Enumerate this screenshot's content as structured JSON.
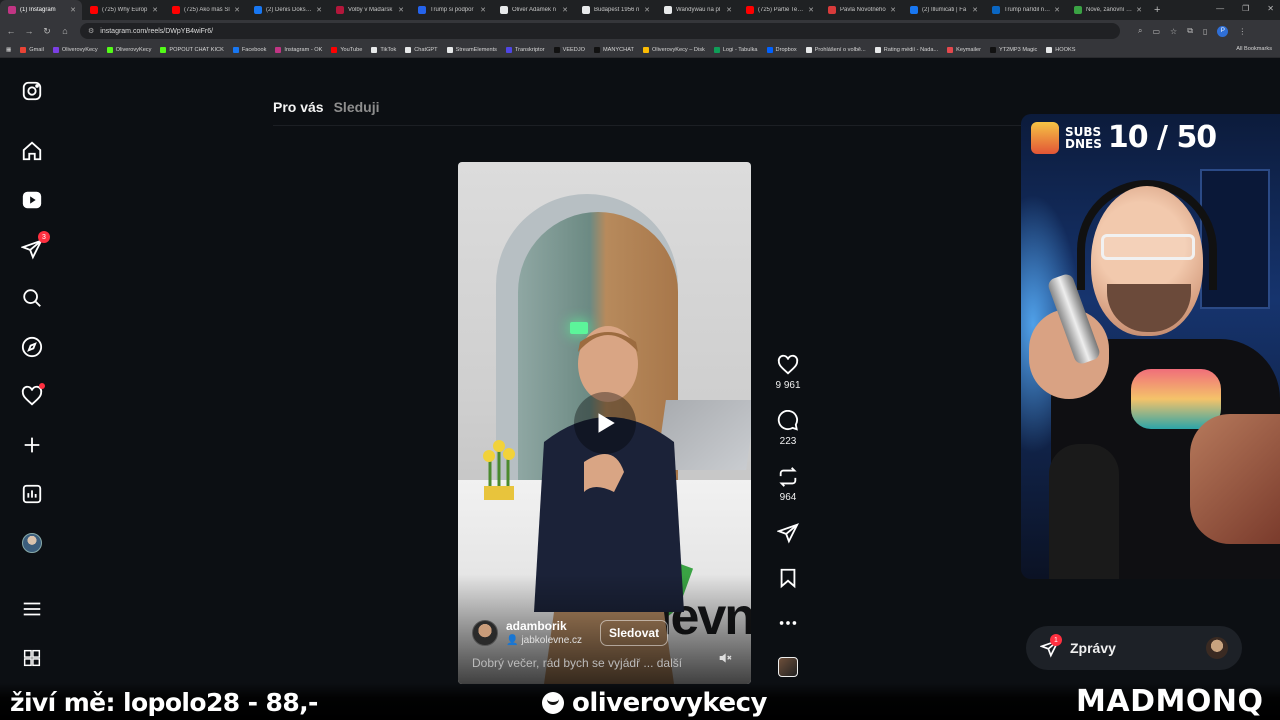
{
  "browser": {
    "tabs": [
      {
        "label": "(1) Instagram",
        "color": "#c13584",
        "active": true
      },
      {
        "label": "(725) Why Europ",
        "color": "#ff0000"
      },
      {
        "label": "(725) Ako máš Sl",
        "color": "#ff0000"
      },
      {
        "label": "(2) Denis Doksan",
        "color": "#1877f2"
      },
      {
        "label": "Volby v Maďarsk",
        "color": "#b3173b"
      },
      {
        "label": "Trump si podpor",
        "color": "#2563eb"
      },
      {
        "label": "Oliver Adámek n",
        "color": "#e7e9ea"
      },
      {
        "label": "Budapest 1956 n",
        "color": "#e7e9ea"
      },
      {
        "label": "Wandywau na pl",
        "color": "#e7e9ea"
      },
      {
        "label": "(725) Partie Terez",
        "color": "#ff0000"
      },
      {
        "label": "Pavla Novotného",
        "color": "#d83b3b"
      },
      {
        "label": "(2) Illumicati | Fa",
        "color": "#1877f2"
      },
      {
        "label": "Trump nařídil náv",
        "color": "#0a66c2"
      },
      {
        "label": "Nové, zánovní a p",
        "color": "#3aa344"
      }
    ],
    "url": "instagram.com/reels/DWpYB4wiFr6/",
    "bookmarks": [
      {
        "label": "Gmail",
        "color": "#ea4335"
      },
      {
        "label": "OliverovyKecy",
        "color": "#7b3fe4"
      },
      {
        "label": "OliverovyKecy",
        "color": "#53fc18"
      },
      {
        "label": "POPOUT CHAT KICK",
        "color": "#53fc18"
      },
      {
        "label": "Facebook",
        "color": "#1877f2"
      },
      {
        "label": "Instagram - OK",
        "color": "#c13584"
      },
      {
        "label": "YouTube",
        "color": "#ff0000"
      },
      {
        "label": "TikTok",
        "color": "#e7e9ea"
      },
      {
        "label": "ChatGPT",
        "color": "#e7e9ea"
      },
      {
        "label": "StreamElements",
        "color": "#e7e9ea"
      },
      {
        "label": "Transkriptor",
        "color": "#4f46e5"
      },
      {
        "label": "VEEDJO",
        "color": "#111111"
      },
      {
        "label": "MANYCHAT",
        "color": "#111111"
      },
      {
        "label": "OliverovyKecy – Disk",
        "color": "#fbbc04"
      },
      {
        "label": "Logi - Tabulka",
        "color": "#0f9d58"
      },
      {
        "label": "Dropbox",
        "color": "#0061ff"
      },
      {
        "label": "Prohlášení o volbě...",
        "color": "#e7e9ea"
      },
      {
        "label": "Rating médií - Nada...",
        "color": "#e7e9ea"
      },
      {
        "label": "Keymailer",
        "color": "#e5484d"
      },
      {
        "label": "YT2MP3 Magic",
        "color": "#111111"
      },
      {
        "label": "HOOKS",
        "color": "#e7e9ea"
      }
    ],
    "all_bookmarks": "All Bookmarks"
  },
  "instagram": {
    "nav_badges": {
      "messages": "3"
    },
    "feed_tabs": {
      "for_you": "Pro vás",
      "following": "Sleduji"
    },
    "reel": {
      "username": "adamborik",
      "audio": "jabkolevne.cz",
      "follow": "Sledovat",
      "caption": "Dobrý večer, rád bych se vyjádř",
      "caption_more": "... další",
      "brand": "levn"
    },
    "actions": {
      "likes": "9 961",
      "comments": "223",
      "reposts": "964"
    },
    "messages": {
      "label": "Zprávy",
      "badge": "1"
    }
  },
  "stream": {
    "subs_label_1": "SUBS",
    "subs_label_2": "DNES",
    "subs_count": "10 / 50",
    "donor": "živí mě: lopolo28 - 88,-",
    "channel": "oliverovykecy",
    "brand": "MADMONQ"
  }
}
